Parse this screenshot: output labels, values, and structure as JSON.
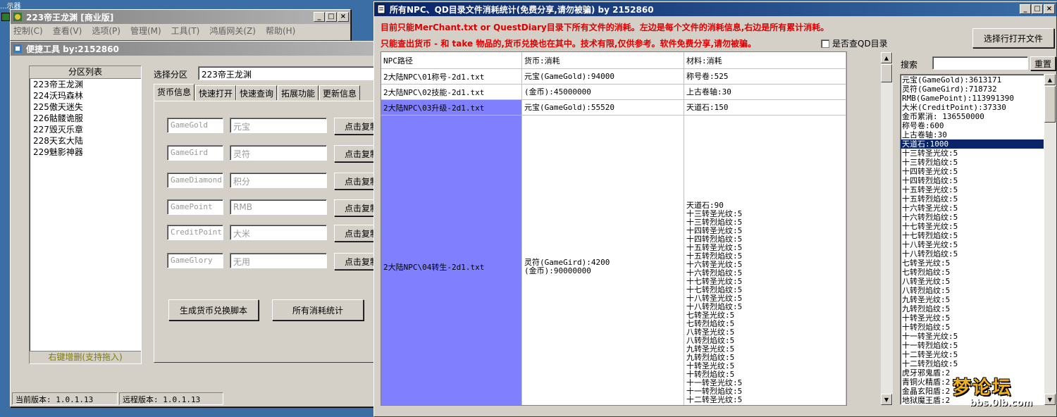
{
  "desktop": {
    "top_left_label": "...示器"
  },
  "main_window": {
    "title": "223帝王龙渊 [商业版]",
    "menu": [
      "控制(C)",
      "查看(V)",
      "选项(P)",
      "管理(M)",
      "工具(T)",
      "鸿盾网关(Z)",
      "帮助(H)"
    ]
  },
  "tool_window": {
    "title": "便捷工具   by:2152860",
    "partition_list_header": "分区列表",
    "partitions": [
      "223帝王龙渊",
      "224沃玛森林",
      "225傲天迷失",
      "226骷髅诡服",
      "227毁灭乐章",
      "228天玄大陆",
      "229魅影神器"
    ],
    "partition_footer": "右键增删(支持拖入)",
    "select_partition_label": "选择分区",
    "selected_partition": "223帝王龙渊",
    "tabs": [
      "货币信息",
      "快速打开",
      "快速查询",
      "拓展功能",
      "更新信息"
    ],
    "currency_rows": [
      {
        "code": "GameGold",
        "name": "元宝",
        "button": "点击复制"
      },
      {
        "code": "GameGird",
        "name": "灵符",
        "button": "点击复制"
      },
      {
        "code": "GameDiamond",
        "name": "积分",
        "button": "点击复制"
      },
      {
        "code": "GamePoint",
        "name": "RMB",
        "button": "点击复制"
      },
      {
        "code": "CreditPoint",
        "name": "大米",
        "button": "点击复制"
      },
      {
        "code": "GameGlory",
        "name": "无用",
        "button": "点击复制"
      }
    ],
    "gen_script_button": "生成货币兑换脚本",
    "all_stats_button": "所有消耗统计",
    "status_current": "当前版本: 1.0.1.13",
    "status_remote": "远程版本: 1.0.1.13"
  },
  "stats_window": {
    "title": "所有NPC、QD目录文件消耗统计(免费分享,请勿被骗)     by 2152860",
    "notice_line1": "目前只能MerChant.txt or QuestDiary目录下所有文件的消耗。左边是每个文件的消耗信息,右边是所有累计消耗。",
    "notice_line2": "只能查出货币 - 和 take 物品的,货币兑换也在其中。技术有限,仅供参考。软件免费分享,请勿被骗。",
    "qd_checkbox_label": "是否查QD目录",
    "open_file_button": "选择行打开文件",
    "search_label": "搜索",
    "search_value": "",
    "reset_button": "重置",
    "grid_headers": [
      "NPC路径",
      "货币:消耗",
      "材料:消耗"
    ],
    "grid_rows": [
      {
        "path": "2大陆NPC\\01称号-2d1.txt",
        "currency": [
          "元宝(GameGold):94000"
        ],
        "materials": [
          "称号卷:525"
        ]
      },
      {
        "path": "2大陆NPC\\02技能-2d1.txt",
        "currency": [
          "(金币):45000000"
        ],
        "materials": [
          "上古卷轴:30"
        ]
      },
      {
        "path": "2大陆NPC\\03升级-2d1.txt",
        "currency": [
          "元宝(GameGold):55520"
        ],
        "materials": [
          "天道石:150"
        ]
      },
      {
        "path": "2大陆NPC\\04转生-2d1.txt",
        "currency": [
          "灵符(GameGird):4200",
          "(金币):90000000"
        ],
        "materials": [
          "天道石:90",
          "十三转圣光纹:5",
          "十三转烈焰纹:5",
          "十四转圣光纹:5",
          "十四转烈焰纹:5",
          "十五转圣光纹:5",
          "十五转烈焰纹:5",
          "十六转圣光纹:5",
          "十六转烈焰纹:5",
          "十七转圣光纹:5",
          "十七转烈焰纹:5",
          "十八转圣光纹:5",
          "十八转烈焰纹:5",
          "七转圣光纹:5",
          "七转烈焰纹:5",
          "八转圣光纹:5",
          "八转烈焰纹:5",
          "九转圣光纹:5",
          "九转烈焰纹:5",
          "十转圣光纹:5",
          "十转烈焰纹:5",
          "十一转圣光纹:5",
          "十一转烈焰纹:5",
          "十二转圣光纹:5"
        ]
      }
    ],
    "summary": [
      "元宝(GameGold):3613171",
      "灵符(GameGird):718732",
      "RMB(GamePoint):113991390",
      "大米(CreditPoint):37330",
      "金币累消: 136550000",
      "称号卷:600",
      "上古卷轴:30",
      "天道石:1000",
      "十三转圣光纹:5",
      "十三转烈焰纹:5",
      "十四转圣光纹:5",
      "十四转烈焰纹:5",
      "十五转圣光纹:5",
      "十五转烈焰纹:5",
      "十六转圣光纹:5",
      "十六转烈焰纹:5",
      "十七转圣光纹:5",
      "十七转烈焰纹:5",
      "十八转圣光纹:5",
      "十八转烈焰纹:5",
      "七转圣光纹:5",
      "七转烈焰纹:5",
      "八转圣光纹:5",
      "八转烈焰纹:5",
      "九转圣光纹:5",
      "九转烈焰纹:5",
      "十转圣光纹:5",
      "十转烈焰纹:5",
      "十一转圣光纹:5",
      "十一转烈焰纹:5",
      "十二转圣光纹:5",
      "十二转烈焰纹:5",
      "虎牙邪鬼盾:2",
      "青铜火精盾:2",
      "金晶玄阳盾:2",
      "地狱魔王盾:2"
    ],
    "summary_selected_index": 7
  },
  "watermark": {
    "text": "梦论坛",
    "url": "bbs.0lb.com"
  },
  "colors": {
    "title_active": "#0a246a",
    "selection_row": "#8080ff",
    "notice_red": "#e00000"
  }
}
